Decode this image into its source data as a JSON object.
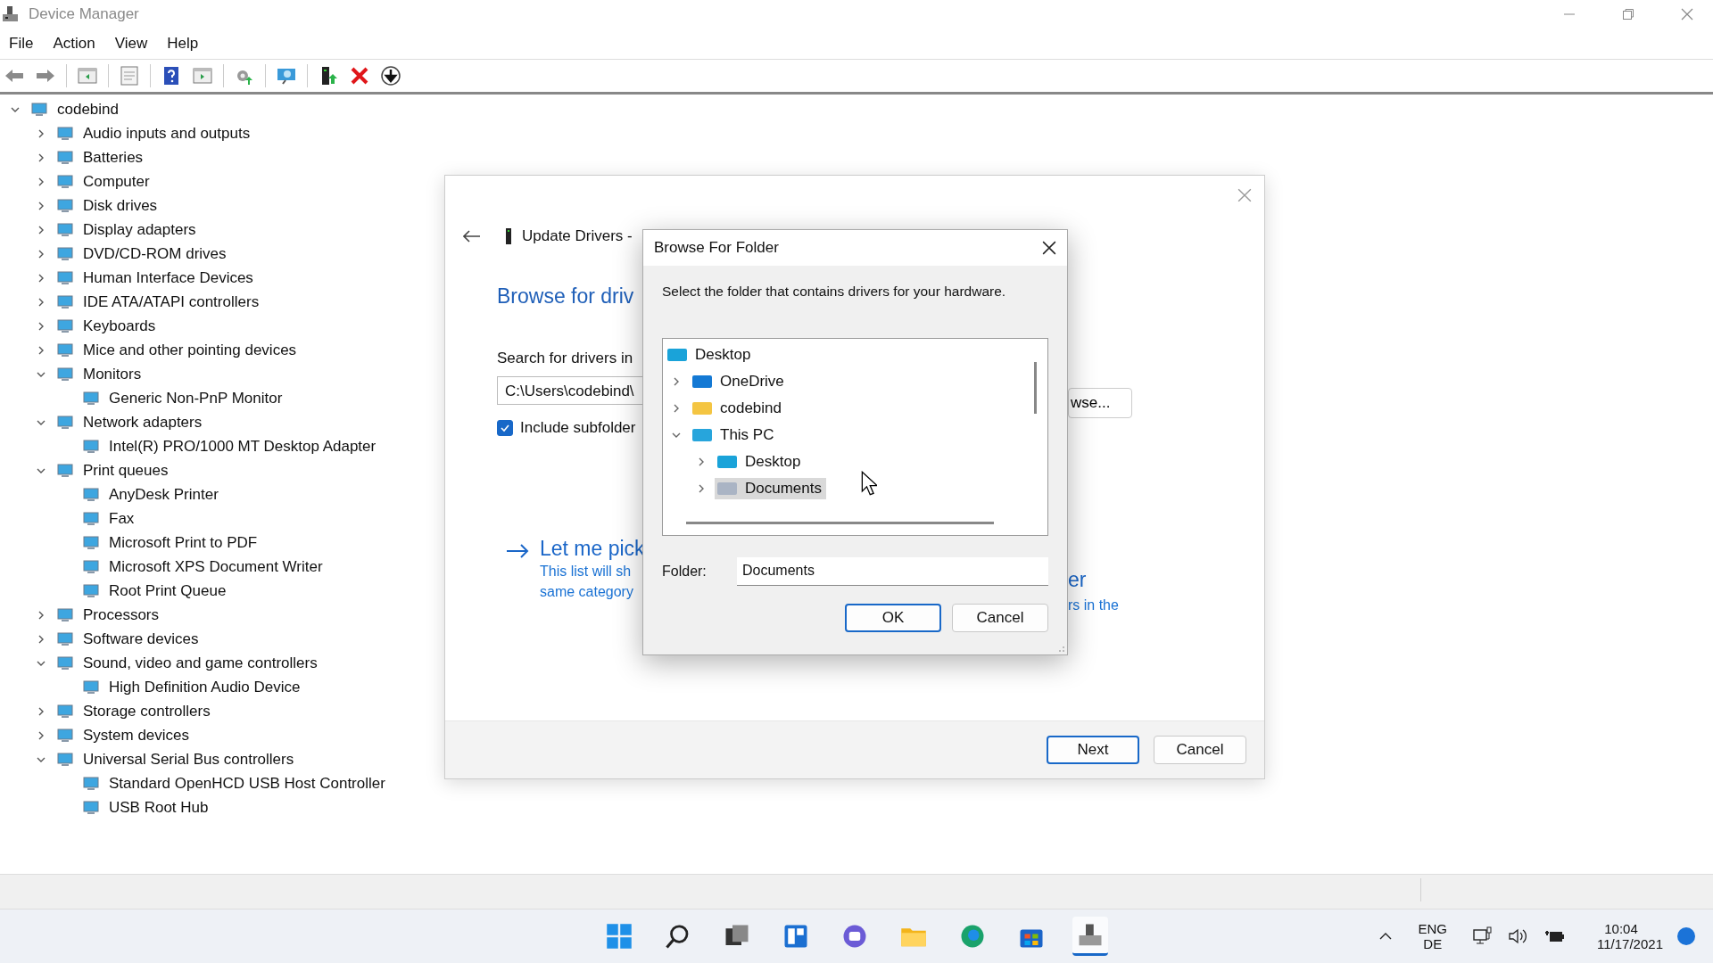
{
  "window": {
    "title": "Device Manager"
  },
  "menu": [
    "File",
    "Action",
    "View",
    "Help"
  ],
  "tree": {
    "label": "codebind",
    "expanded": true,
    "children": [
      {
        "label": "Audio inputs and outputs",
        "expanded": false
      },
      {
        "label": "Batteries",
        "expanded": false
      },
      {
        "label": "Computer",
        "expanded": false
      },
      {
        "label": "Disk drives",
        "expanded": false
      },
      {
        "label": "Display adapters",
        "expanded": false
      },
      {
        "label": "DVD/CD-ROM drives",
        "expanded": false
      },
      {
        "label": "Human Interface Devices",
        "expanded": false
      },
      {
        "label": "IDE ATA/ATAPI controllers",
        "expanded": false
      },
      {
        "label": "Keyboards",
        "expanded": false
      },
      {
        "label": "Mice and other pointing devices",
        "expanded": false
      },
      {
        "label": "Monitors",
        "expanded": true,
        "children": [
          {
            "label": "Generic Non-PnP Monitor"
          }
        ]
      },
      {
        "label": "Network adapters",
        "expanded": true,
        "children": [
          {
            "label": "Intel(R) PRO/1000 MT Desktop Adapter"
          }
        ]
      },
      {
        "label": "Print queues",
        "expanded": true,
        "children": [
          {
            "label": "AnyDesk Printer"
          },
          {
            "label": "Fax"
          },
          {
            "label": "Microsoft Print to PDF"
          },
          {
            "label": "Microsoft XPS Document Writer"
          },
          {
            "label": "Root Print Queue"
          }
        ]
      },
      {
        "label": "Processors",
        "expanded": false
      },
      {
        "label": "Software devices",
        "expanded": false
      },
      {
        "label": "Sound, video and game controllers",
        "expanded": true,
        "children": [
          {
            "label": "High Definition Audio Device"
          }
        ]
      },
      {
        "label": "Storage controllers",
        "expanded": false
      },
      {
        "label": "System devices",
        "expanded": false
      },
      {
        "label": "Universal Serial Bus controllers",
        "expanded": true,
        "children": [
          {
            "label": "Standard OpenHCD USB Host Controller"
          },
          {
            "label": "USB Root Hub"
          }
        ]
      }
    ]
  },
  "update_dialog": {
    "title": "Update Drivers -",
    "heading": "Browse for driv",
    "search_label": "Search for drivers in",
    "path": "C:\\Users\\codebind\\",
    "include_subfolders": {
      "label": "Include subfolder",
      "checked": true
    },
    "browse_button": "wse...",
    "pick_link": {
      "left": "Let me pick",
      "right": "er"
    },
    "pick_desc": {
      "left": [
        "This list will sh",
        "same category"
      ],
      "right": "rs in the"
    },
    "buttons": [
      {
        "label": "Next",
        "default": true
      },
      {
        "label": "Cancel",
        "default": false
      }
    ]
  },
  "browse_dialog": {
    "title": "Browse For Folder",
    "instruction": "Select the folder that contains drivers for your hardware.",
    "folders": [
      {
        "label": "Desktop",
        "kind": "desktop",
        "selected": false
      },
      {
        "label": "OneDrive",
        "kind": "cloud",
        "expanded": false,
        "selected": false
      },
      {
        "label": "codebind",
        "kind": "folder",
        "expanded": false,
        "selected": false
      },
      {
        "label": "This PC",
        "kind": "pc",
        "expanded": true,
        "selected": false,
        "children": [
          {
            "label": "Desktop",
            "kind": "desktop",
            "expanded": false,
            "selected": false
          },
          {
            "label": "Documents",
            "kind": "documents",
            "expanded": false,
            "selected": true
          }
        ]
      }
    ],
    "folder_label": "Folder:",
    "folder_value": "Documents",
    "buttons": [
      {
        "label": "OK",
        "default": true
      },
      {
        "label": "Cancel",
        "default": false
      }
    ]
  },
  "taskbar": {
    "apps": [
      {
        "kind": "start",
        "active": false
      },
      {
        "kind": "search",
        "active": false
      },
      {
        "kind": "taskview",
        "active": false
      },
      {
        "kind": "widgets",
        "active": false
      },
      {
        "kind": "chat",
        "active": false
      },
      {
        "kind": "explorer",
        "active": false
      },
      {
        "kind": "edge",
        "active": false
      },
      {
        "kind": "store",
        "active": false
      },
      {
        "kind": "devmgr",
        "active": true
      }
    ],
    "language": [
      "ENG",
      "DE"
    ],
    "time": "10:04",
    "date": "11/17/2021"
  }
}
